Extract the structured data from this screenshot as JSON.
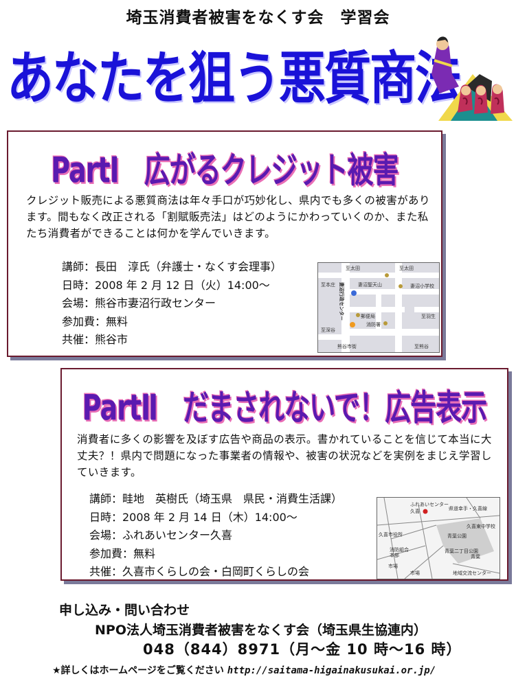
{
  "header": {
    "org_title": "埼玉消費者被害をなくす会　学習会",
    "main_title": "あなたを狙う悪質商法"
  },
  "part1": {
    "title": "PartⅠ　広がるクレジット被害",
    "description": "クレジット販売による悪質商法は年々手口が巧妙化し、県内でも多くの被害があります。間もなく改正される「割賦販売法」はどのようにかわっていくのか、また私たち消費者ができることは何かを学んでいきます。",
    "lecturer": "講師：長田　淳氏（弁護士・なくす会理事）",
    "datetime": "日時：2008 年 2 月 12 日（火）14:00～",
    "venue": "会場：熊谷市妻沼行政センター",
    "fee": "参加費：無料",
    "cohost": "共催：熊谷市",
    "map": {
      "labels": [
        "至太田",
        "至太田",
        "妻沼聖天山",
        "至本庄",
        "妻沼行政センター",
        "妻沼小学校",
        "郵便局",
        "消防署",
        "至羽生",
        "至深谷",
        "熊谷市街",
        "至熊谷"
      ]
    }
  },
  "part2": {
    "title": "PartⅡ　だまされないで！広告表示",
    "description": "消費者に多くの影響を及ぼす広告や商品の表示。書かれていることを信じて本当に大丈夫？！県内で問題になった事業者の情報や、被害の状況などを実例をまじえ学習していきます。",
    "lecturer": "講師：畦地　英樹氏（埼玉県　県民・消費生活課）",
    "datetime": "日時：2008 年 2 月 14 日（木）14:00～",
    "venue": "会場：ふれあいセンター久喜",
    "fee": "参加費：無料",
    "cohost": "共催：久喜市くらしの会・白岡町くらしの会",
    "map": {
      "labels": [
        "ふれあいセンター",
        "久喜",
        "県道幸手・久喜線",
        "久喜東中学校",
        "青葉公園",
        "久喜市役所",
        "青葉二丁目公園",
        "市場",
        "消防組合",
        "本部",
        "青葉",
        "市場",
        "地域交流センター"
      ]
    }
  },
  "contact": {
    "heading": "申し込み・問い合わせ",
    "org": "NPO法人埼玉消費者被害をなくす会（埼玉県生協連内）",
    "phone": "048（844）8971（月～金 10 時～16 時）",
    "note": "★詳しくはホームページをご覧ください",
    "url": "http://saitama-higainakusukai.or.jp/"
  },
  "colors": {
    "main_title": "#1a12d8",
    "part_title": "#5a1ab0",
    "part_title_shadow": "#e96fb6",
    "card_border": "#6a1a2e"
  }
}
